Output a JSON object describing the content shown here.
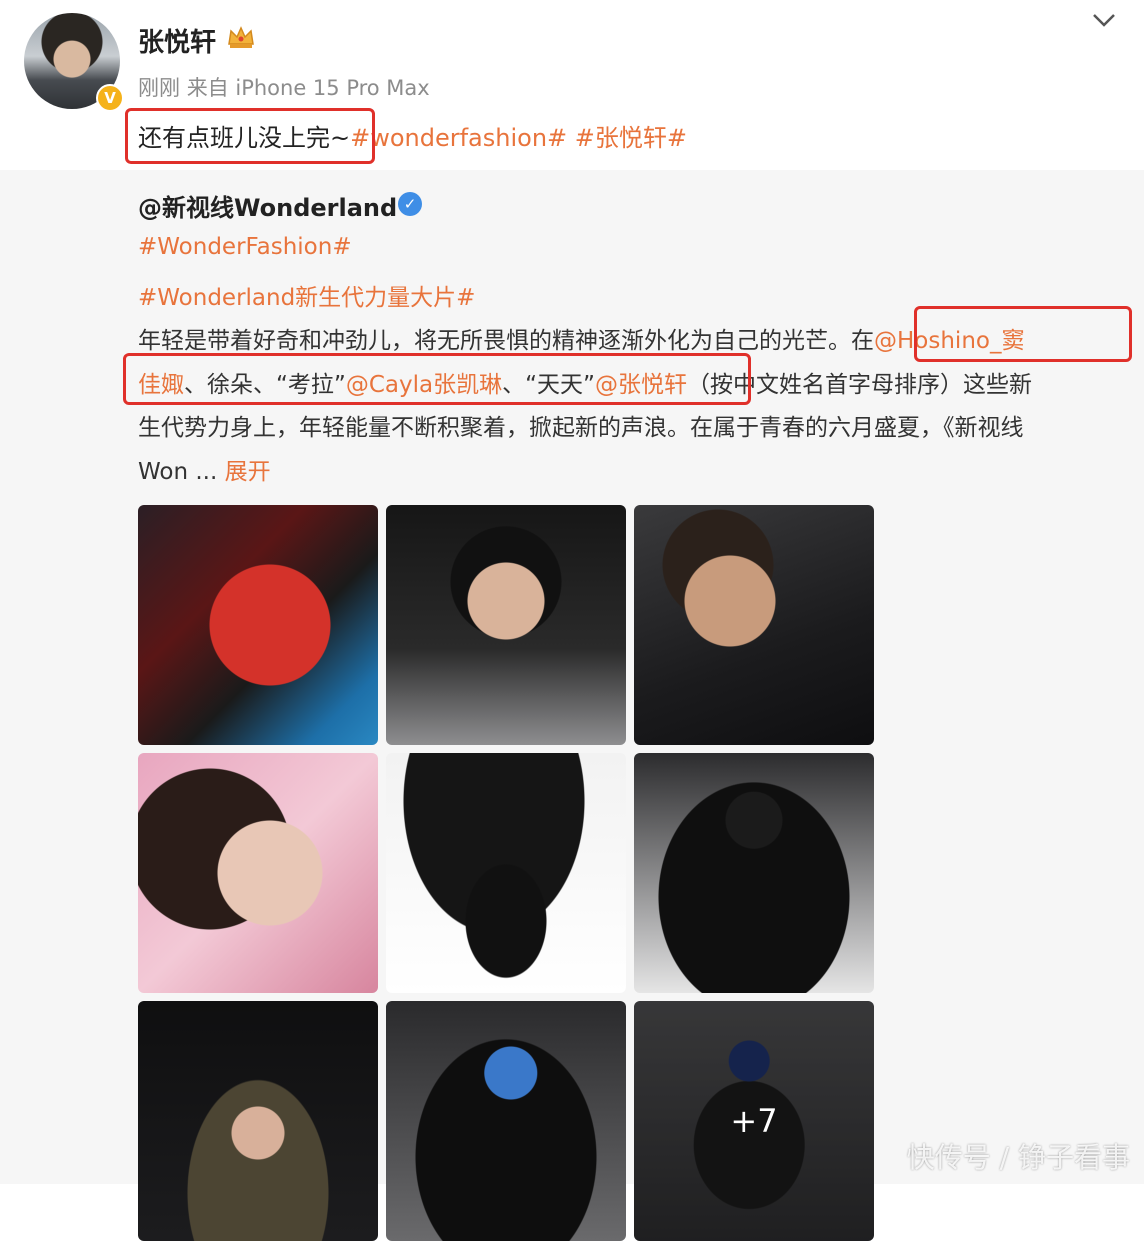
{
  "post": {
    "username": "张悦轩",
    "time": "刚刚",
    "source": "来自 iPhone 15 Pro Max",
    "text_plain": "还有点班儿没上完",
    "text_tilde": "~",
    "tag1": "#wonderfashion#",
    "tag2": "#张悦轩#"
  },
  "repost": {
    "author": "@新视线Wonderland",
    "tag1": "#WonderFashion#",
    "tag2": "#Wonderland新生代力量大片#",
    "line1_plain": "年轻是带着好奇和冲劲儿，将无所畏惧的精神逐渐外化为自己的光芒。",
    "line1_zai": "在",
    "line1_mention": "@Hoshino_窦",
    "line2_mention_a": "佳娵",
    "line2_plain_a": "、徐朵、“考拉”",
    "line2_mention_b": "@Cayla张凯琳",
    "line2_plain_b": "、“天天”",
    "line2_mention_c": "@张悦轩",
    "line2_plain_c": "（按中文姓名首字母排序）这些新",
    "line3": "生代势力身上，年轻能量不断积聚着，掀起新的声浪。在属于青春的六月盛夏，《新视线",
    "line4": "Won  ...",
    "more": "展开"
  },
  "gallery": {
    "more_count": "+7",
    "images": [
      "photo-red-blue-portrait",
      "photo-girl-silver-jacket",
      "photo-boy-necklace",
      "photo-girl-pink-stars",
      "photo-black-dress-balloon",
      "photo-sitting-leather",
      "photo-girl-arms-up",
      "photo-blue-hair-reclining",
      "photo-cap-sequin-dress"
    ]
  },
  "watermark": "快传号 / 铮子看事"
}
